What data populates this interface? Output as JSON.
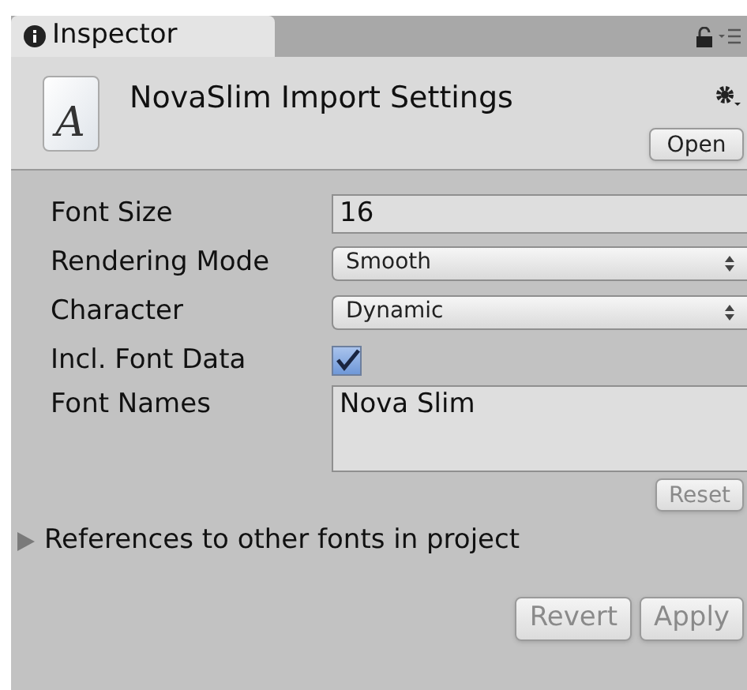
{
  "tab": {
    "label": "Inspector",
    "selected": true
  },
  "header": {
    "icon_letter": "A",
    "title": "NovaSlim Import Settings",
    "open_button": "Open"
  },
  "fields": [
    {
      "kind": "text",
      "label": "Font Size",
      "value": "16"
    },
    {
      "kind": "dropdown",
      "label": "Rendering Mode",
      "value": "Smooth"
    },
    {
      "kind": "dropdown",
      "label": "Character",
      "value": "Dynamic"
    },
    {
      "kind": "checkbox",
      "label": "Incl. Font Data",
      "checked": true
    },
    {
      "kind": "textarea",
      "label": "Font Names",
      "value": "Nova Slim"
    }
  ],
  "reset_button": {
    "label": "Reset",
    "disabled": true
  },
  "references": {
    "label": "References to other fonts in project",
    "expanded": false
  },
  "buttons": [
    {
      "label": "Revert",
      "disabled": true
    },
    {
      "label": "Apply",
      "disabled": true
    }
  ]
}
